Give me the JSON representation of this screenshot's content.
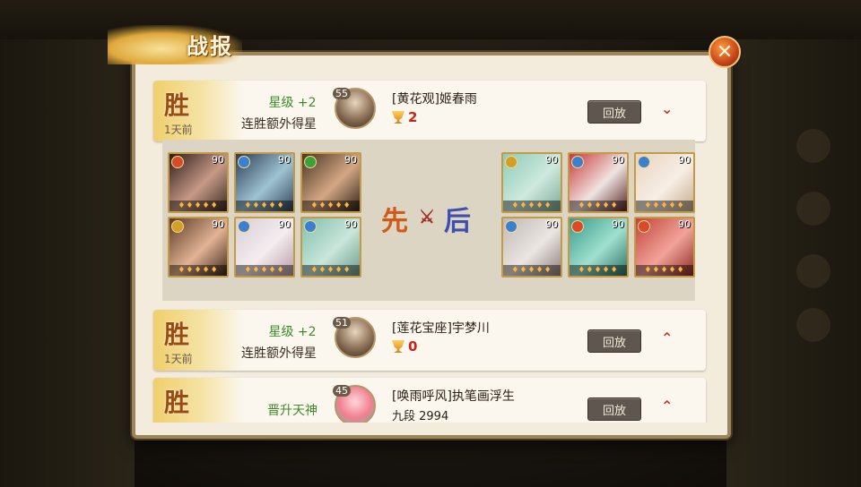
{
  "dialog": {
    "title": "战报",
    "close_glyph": "✕"
  },
  "battles": [
    {
      "result": "胜",
      "time": "1天前",
      "star_change": "星级 +2",
      "bonus_text": "连胜额外得星",
      "opponent": {
        "level": "55",
        "name": "[黄花观]姬春雨",
        "score": "2"
      },
      "replay_label": "回放",
      "toggle_glyph": "⌄",
      "expanded": true,
      "lineup": {
        "vs_first": "先",
        "vs_cross": "⚔",
        "vs_second": "后",
        "left_levels": [
          "90",
          "90",
          "90",
          "90",
          "90",
          "90"
        ],
        "right_levels": [
          "90",
          "90",
          "90",
          "90",
          "90",
          "90"
        ]
      }
    },
    {
      "result": "胜",
      "time": "1天前",
      "star_change": "星级 +2",
      "bonus_text": "连胜额外得星",
      "opponent": {
        "level": "51",
        "name": "[莲花宝座]宇梦川",
        "score": "0"
      },
      "replay_label": "回放",
      "toggle_glyph": "⌃",
      "expanded": false
    },
    {
      "result": "胜",
      "time": "",
      "star_change": "晋升天神",
      "bonus_text": "",
      "opponent": {
        "level": "45",
        "name": "[唤雨呼风]执笔画浮生",
        "rank": "九段 2994"
      },
      "replay_label": "回放",
      "toggle_glyph": "⌃",
      "expanded": false
    }
  ],
  "colors": {
    "accent": "#c23a22",
    "win": "#9b4a10",
    "star": "#3f8a2a",
    "score": "#c8241b"
  }
}
